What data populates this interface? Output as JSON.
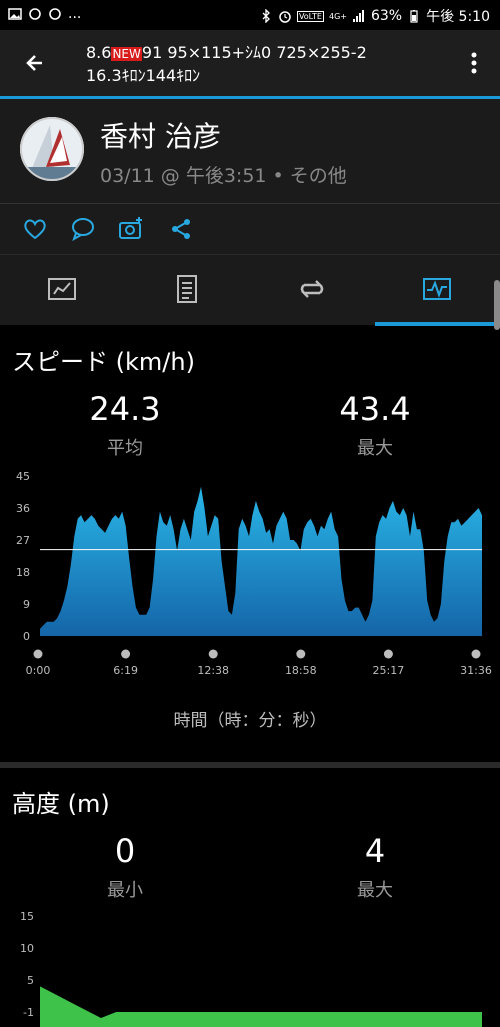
{
  "status_bar": {
    "battery": "63%",
    "time": "午後 5:10",
    "lte": "4G+"
  },
  "app_bar": {
    "title_line1_a": "8.6",
    "title_new": "NEW",
    "title_line1_b": "91 95×115+ｼﾑ0 725×255-2",
    "title_line2": "16.3ｷﾛﾝ144ｷﾛﾝ"
  },
  "profile": {
    "name": "香村 治彦",
    "subline": "03/11 @ 午後3:51 • その他"
  },
  "speed": {
    "title": "スピード (km/h)",
    "avg_value": "24.3",
    "avg_label": "平均",
    "max_value": "43.4",
    "max_label": "最大",
    "x_axis_title": "時間（時：分：秒）"
  },
  "altitude": {
    "title": "高度 (m)",
    "min_value": "0",
    "min_label": "最小",
    "max_value": "4",
    "max_label": "最大"
  },
  "colors": {
    "accent": "#1a9ad6",
    "speed_fill_top": "#29b6e8",
    "speed_fill_bottom": "#1565a8",
    "altitude_fill": "#3ec24a"
  },
  "chart_data": [
    {
      "type": "area",
      "title": "スピード (km/h)",
      "xlabel": "時間（時：分：秒）",
      "ylabel": "km/h",
      "ylim": [
        0,
        45
      ],
      "yticks": [
        "45",
        "36",
        "27",
        "18",
        "9",
        "0"
      ],
      "xticks": [
        "0:00",
        "6:19",
        "12:38",
        "18:58",
        "25:17",
        "31:36"
      ],
      "average_line": 24.3,
      "series": [
        {
          "values": [
            2,
            3,
            4,
            4,
            4,
            5,
            7,
            10,
            14,
            20,
            28,
            33,
            34,
            32,
            33,
            34,
            33,
            31,
            30,
            29,
            31,
            33,
            34,
            33,
            35,
            31,
            22,
            14,
            8,
            6,
            6,
            6,
            8,
            16,
            28,
            35,
            32,
            31,
            34,
            30,
            24,
            30,
            33,
            30,
            27,
            35,
            38,
            42,
            36,
            28,
            31,
            34,
            33,
            21,
            14,
            7,
            6,
            12,
            30,
            33,
            31,
            28,
            34,
            38,
            35,
            33,
            29,
            30,
            26,
            31,
            33,
            35,
            33,
            27,
            27,
            26,
            24,
            30,
            32,
            33,
            31,
            28,
            31,
            30,
            33,
            35,
            30,
            28,
            16,
            10,
            7,
            7,
            8,
            8,
            6,
            4,
            6,
            10,
            28,
            32,
            34,
            33,
            36,
            38,
            35,
            34,
            36,
            34,
            28,
            35,
            30,
            30,
            24,
            10,
            6,
            4,
            5,
            9,
            21,
            28,
            32,
            32,
            33,
            31,
            32,
            33,
            34,
            35,
            36,
            34
          ]
        }
      ]
    },
    {
      "type": "area",
      "title": "高度 (m)",
      "ylabel": "m",
      "yticks": [
        "15",
        "10",
        "5",
        "-1"
      ],
      "series": [
        {
          "values": [
            4,
            3,
            2,
            1,
            0,
            0,
            0,
            0,
            0,
            0,
            0,
            0,
            0,
            0,
            0,
            0,
            0,
            0,
            0,
            0,
            0,
            0,
            0,
            0,
            0,
            0,
            0,
            0,
            0,
            0
          ]
        }
      ]
    }
  ]
}
